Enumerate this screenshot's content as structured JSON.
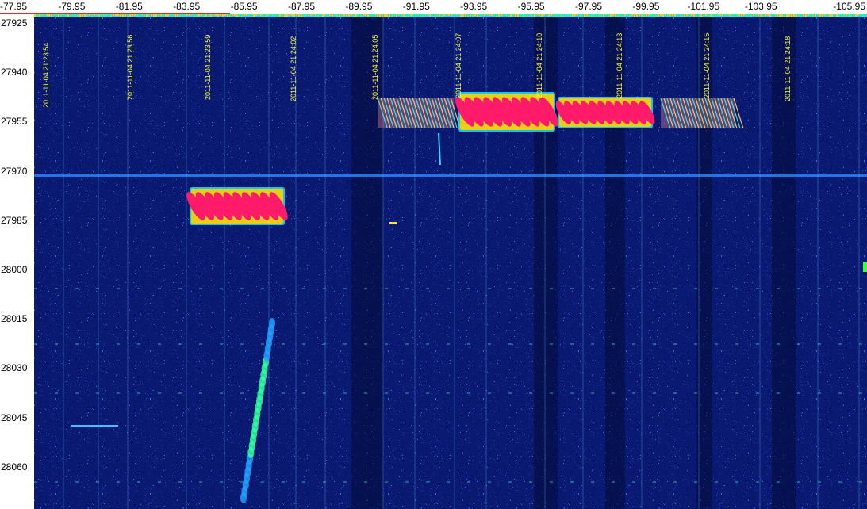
{
  "x_axis": {
    "labels": [
      "-77.95",
      "-79.95",
      "-81.95",
      "-83.95",
      "-85.95",
      "-87.95",
      "-89.95",
      "-91.95",
      "-93.95",
      "-95.95",
      "-97.95",
      "-99.95",
      "-101.95",
      "-103.95",
      "-105.95"
    ]
  },
  "y_axis": {
    "labels": [
      "27925",
      "27940",
      "27955",
      "27970",
      "27985",
      "28000",
      "28015",
      "28030",
      "28045",
      "28060"
    ]
  },
  "timestamps": [
    "2011-11-04 21:23:54",
    "2011-11-04 21:23:56",
    "2011-11-04 21:23:59",
    "2011-11-04 21:24:02",
    "2011-11-04 21:24:05",
    "2011-11-04 21:24:07",
    "2011-11-04 21:24:10",
    "2011-11-04 21:24:13",
    "2011-11-04 21:24:15",
    "2011-11-04 21:24:18"
  ],
  "colors": {
    "background": "#0a1a72",
    "signal_hot": "#ff1a6a",
    "signal_mid": "#ffd000",
    "signal_low": "#20e0ff",
    "timestamp_text": "#ffff40"
  }
}
